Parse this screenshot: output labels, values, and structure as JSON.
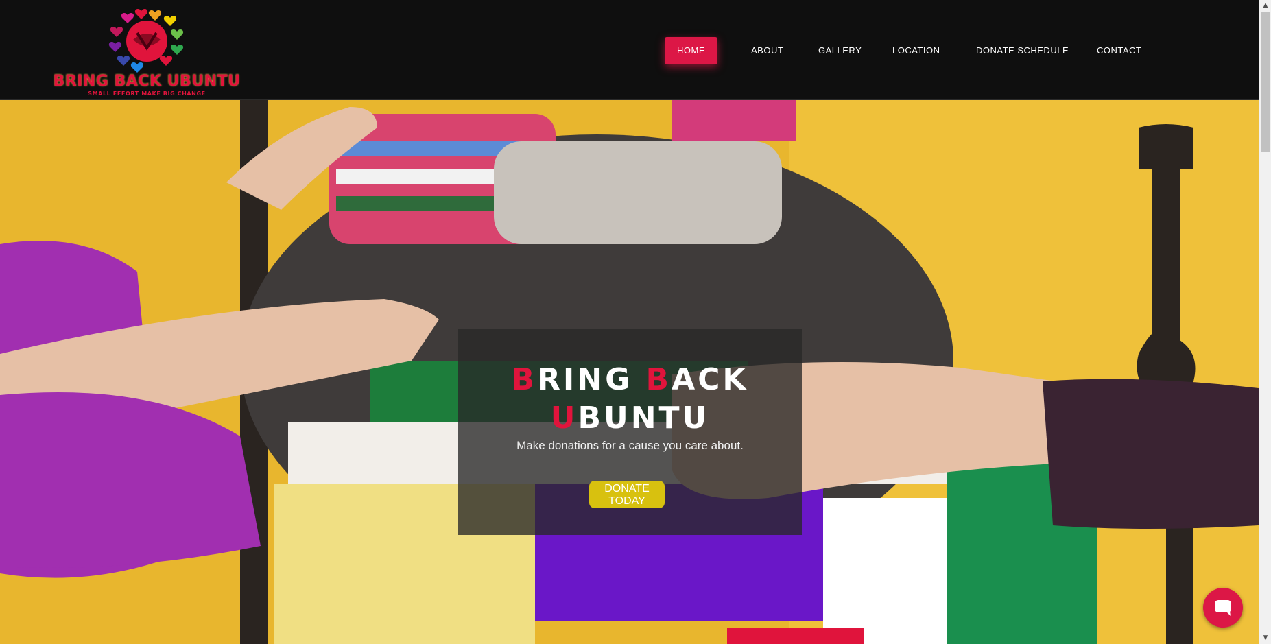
{
  "brand": {
    "name": "BRING BACK UBUNTU",
    "tagline": "SMALL EFFORT MAKE BIG CHANGE"
  },
  "nav": {
    "items": [
      {
        "label": "HOME",
        "active": true
      },
      {
        "label": "ABOUT",
        "active": false
      },
      {
        "label": "GALLERY",
        "active": false
      },
      {
        "label": "LOCATION",
        "active": false
      },
      {
        "label": "DONATE SCHEDULE",
        "active": false
      },
      {
        "label": "CONTACT",
        "active": false
      }
    ]
  },
  "hero": {
    "title_word1_cap": "B",
    "title_word1_rest": "RING",
    "title_word2_cap": "B",
    "title_word2_rest": "ACK",
    "title_word3_cap": "U",
    "title_word3_rest": "BUNTU",
    "subtitle": "Make donations for a cause you care about.",
    "button_line1": "DONATE",
    "button_line2": "TODAY"
  },
  "icons": {
    "logo": "ubuntu-hands-hearts-logo",
    "chat": "chat-bubble-icon"
  },
  "colors": {
    "accent": "#dc1746",
    "brand_red": "#e0143c",
    "button_yellow": "#d8c10f",
    "header_bg": "#0f0f0f",
    "wall_yellow": "#e8b62e"
  }
}
